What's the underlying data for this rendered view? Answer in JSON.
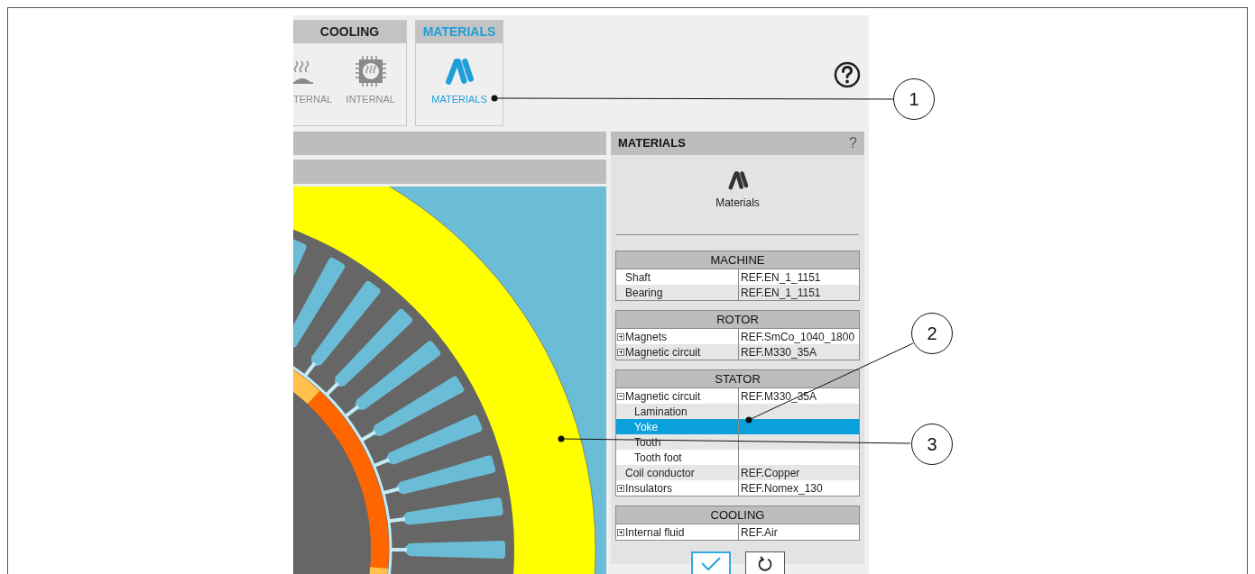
{
  "toolbar": {
    "groups": [
      {
        "title": "COOLING",
        "selected": false,
        "items": [
          {
            "label": "TERNAL",
            "kind": "heater"
          },
          {
            "label": "INTERNAL",
            "kind": "chip"
          }
        ]
      },
      {
        "title": "MATERIALS",
        "selected": true,
        "items": [
          {
            "label": "MATERIALS",
            "kind": "materials"
          }
        ]
      }
    ]
  },
  "panel": {
    "title": "MATERIALS",
    "help": "?",
    "subtitle": "Materials",
    "sections": [
      {
        "title": "MACHINE",
        "rows": [
          {
            "kind": "leaf",
            "label": "Shaft",
            "value": "REF.EN_1_1151",
            "selected": false
          },
          {
            "kind": "leaf",
            "label": "Bearing",
            "value": "REF.EN_1_1151",
            "selected": false
          }
        ]
      },
      {
        "title": "ROTOR",
        "rows": [
          {
            "kind": "group",
            "label": "Magnets",
            "value": "REF.SmCo_1040_1800",
            "expanded": false,
            "selected": false
          },
          {
            "kind": "group",
            "label": "Magnetic circuit",
            "value": "REF.M330_35A",
            "expanded": false,
            "selected": false
          }
        ]
      },
      {
        "title": "STATOR",
        "rows": [
          {
            "kind": "group",
            "label": "Magnetic circuit",
            "value": "REF.M330_35A",
            "expanded": true,
            "selected": false,
            "children": [
              {
                "label": "Lamination",
                "selected": false
              },
              {
                "label": "Yoke",
                "selected": true
              },
              {
                "label": "Tooth",
                "selected": false
              },
              {
                "label": "Tooth foot",
                "selected": false
              }
            ]
          },
          {
            "kind": "leaf",
            "label": "Coil conductor",
            "value": "REF.Copper",
            "selected": false
          },
          {
            "kind": "group",
            "label": "Insulators",
            "value": "REF.Nomex_130",
            "expanded": false,
            "selected": false
          }
        ]
      },
      {
        "title": "COOLING",
        "rows": [
          {
            "kind": "group",
            "label": "Internal fluid",
            "value": "REF.Air",
            "expanded": false,
            "selected": false
          }
        ]
      }
    ]
  },
  "callouts": [
    {
      "label": "1"
    },
    {
      "label": "2"
    },
    {
      "label": "3"
    }
  ]
}
